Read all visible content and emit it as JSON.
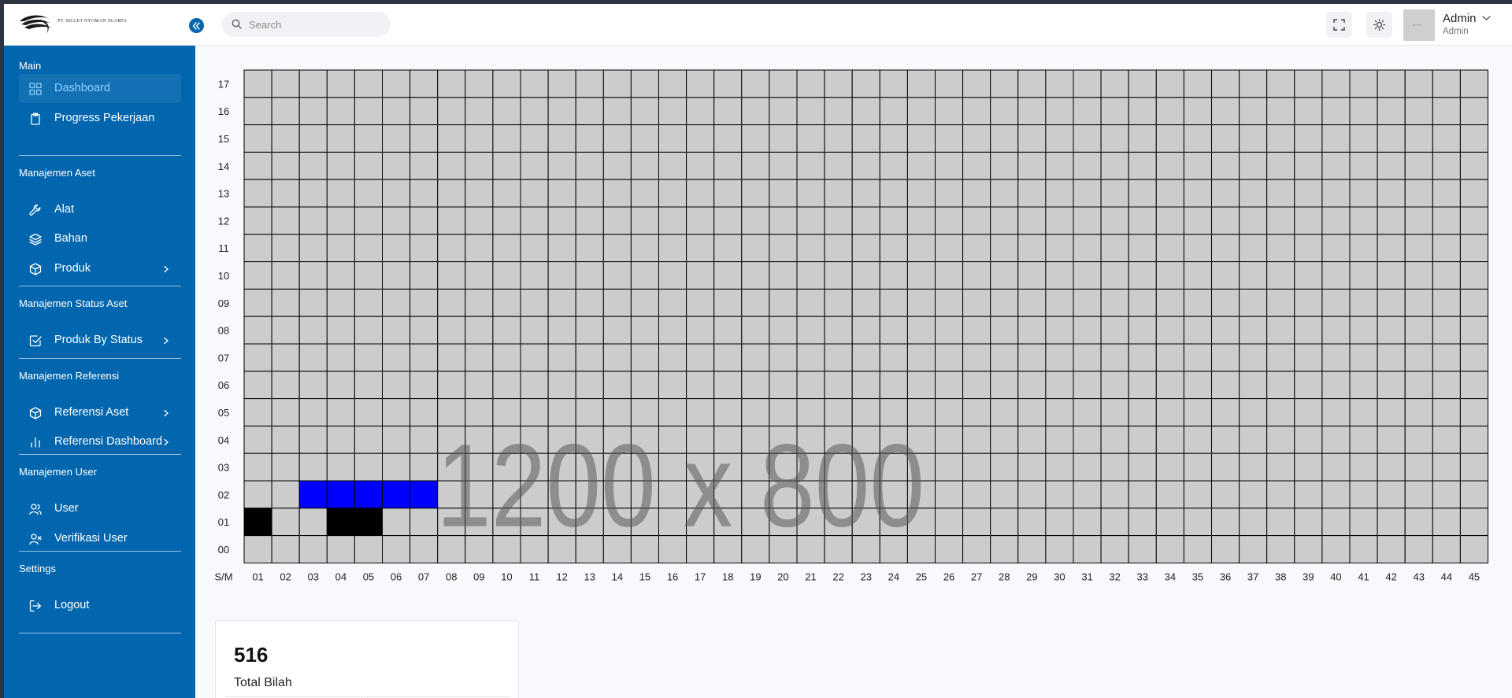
{
  "brand": {
    "logo_text": "PT. SILUET NYOMAN SUARTA"
  },
  "header": {
    "search_placeholder": "Search",
    "user_name": "Admin",
    "user_role": "Admin",
    "avatar_text": "80x80"
  },
  "sidebar": {
    "sections": [
      {
        "title": "Main",
        "items": [
          {
            "label": "Dashboard",
            "icon": "dashboard-grid-icon",
            "active": true,
            "has_submenu": false
          },
          {
            "label": "Progress Pekerjaan",
            "icon": "clipboard-icon",
            "active": false,
            "has_submenu": false
          }
        ]
      },
      {
        "title": "Manajemen Aset",
        "items": [
          {
            "label": "Alat",
            "icon": "wrench-icon",
            "active": false,
            "has_submenu": false
          },
          {
            "label": "Bahan",
            "icon": "layers-icon",
            "active": false,
            "has_submenu": false
          },
          {
            "label": "Produk",
            "icon": "box-icon",
            "active": false,
            "has_submenu": true
          }
        ]
      },
      {
        "title": "Manajemen Status Aset",
        "items": [
          {
            "label": "Produk By Status",
            "icon": "check-square-icon",
            "active": false,
            "has_submenu": true
          }
        ]
      },
      {
        "title": "Manajemen Referensi",
        "items": [
          {
            "label": "Referensi Aset",
            "icon": "box-icon",
            "active": false,
            "has_submenu": true
          },
          {
            "label": "Referensi Dashboard",
            "icon": "bar-chart-icon",
            "active": false,
            "has_submenu": true
          }
        ]
      },
      {
        "title": "Manajemen User",
        "items": [
          {
            "label": "User",
            "icon": "users-icon",
            "active": false,
            "has_submenu": false
          },
          {
            "label": "Verifikasi User",
            "icon": "user-x-icon",
            "active": false,
            "has_submenu": false
          }
        ]
      },
      {
        "title": "Settings",
        "items": [
          {
            "label": "Logout",
            "icon": "logout-icon",
            "active": false,
            "has_submenu": false
          }
        ]
      }
    ]
  },
  "grid": {
    "corner_label": "S/M",
    "columns": [
      "01",
      "02",
      "03",
      "04",
      "05",
      "06",
      "07",
      "08",
      "09",
      "10",
      "11",
      "12",
      "13",
      "14",
      "15",
      "16",
      "17",
      "18",
      "19",
      "20",
      "21",
      "22",
      "23",
      "24",
      "25",
      "26",
      "27",
      "28",
      "29",
      "30",
      "31",
      "32",
      "33",
      "34",
      "35",
      "36",
      "37",
      "38",
      "39",
      "40",
      "41",
      "42",
      "43",
      "44",
      "45"
    ],
    "rows": [
      "17",
      "16",
      "15",
      "14",
      "13",
      "12",
      "11",
      "10",
      "09",
      "08",
      "07",
      "06",
      "05",
      "04",
      "03",
      "02",
      "01",
      "00"
    ],
    "watermark": "1200 x 800",
    "colors": {
      "empty": "#cccccc",
      "blue": "#0000ff",
      "black": "#000000",
      "line": "#000000"
    },
    "filled_cells": [
      {
        "row": "02",
        "col": "03",
        "color": "blue"
      },
      {
        "row": "02",
        "col": "04",
        "color": "blue"
      },
      {
        "row": "02",
        "col": "05",
        "color": "blue"
      },
      {
        "row": "02",
        "col": "06",
        "color": "blue"
      },
      {
        "row": "02",
        "col": "07",
        "color": "blue"
      },
      {
        "row": "01",
        "col": "01",
        "color": "black"
      },
      {
        "row": "01",
        "col": "04",
        "color": "black"
      },
      {
        "row": "01",
        "col": "05",
        "color": "black"
      }
    ]
  },
  "stat_card": {
    "value": "516",
    "label": "Total Bilah"
  },
  "theme": {
    "sidebar_bg": "#0266ae",
    "active_text": "#8fd1ff"
  }
}
